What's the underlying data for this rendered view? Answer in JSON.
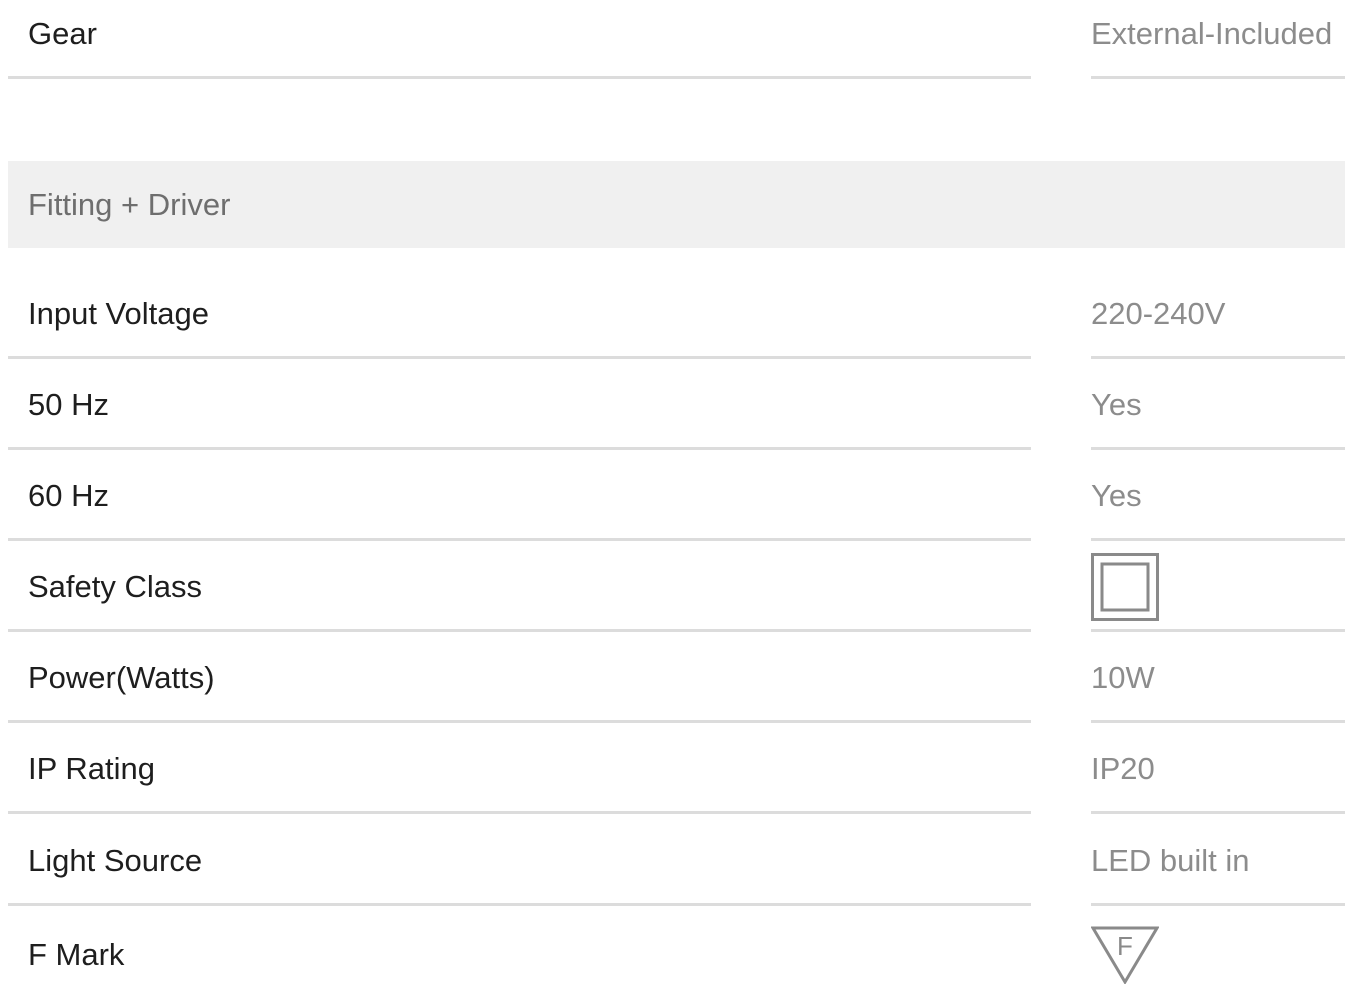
{
  "gear": {
    "label": "Gear",
    "value": "External-Included"
  },
  "section": {
    "title": "Fitting + Driver"
  },
  "rows": [
    {
      "label": "Input Voltage",
      "value": "220-240V"
    },
    {
      "label": "50 Hz",
      "value": "Yes"
    },
    {
      "label": "60 Hz",
      "value": "Yes"
    },
    {
      "label": "Safety Class",
      "icon": "double-square-class-ii-icon"
    },
    {
      "label": "Power(Watts)",
      "value": "10W"
    },
    {
      "label": "IP Rating",
      "value": "IP20"
    },
    {
      "label": "Light Source",
      "value": "LED built in"
    },
    {
      "label": "F Mark",
      "icon": "f-mark-triangle-icon",
      "icon_text": "F"
    }
  ],
  "colors": {
    "label_text": "#1e1e1e",
    "value_text": "#8c8c8c",
    "section_background": "#f0f0f0",
    "divider": "#dcdcdc",
    "icon_stroke": "#8a8a8a"
  }
}
